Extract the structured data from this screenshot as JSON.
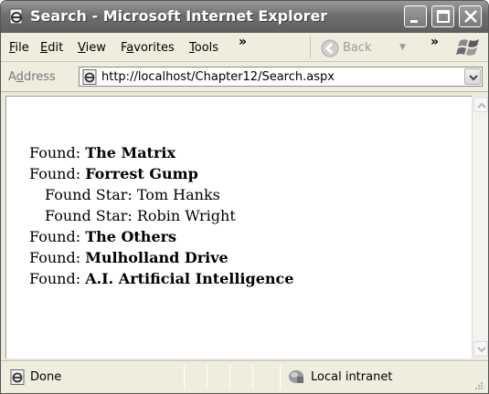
{
  "window": {
    "title": "Search - Microsoft Internet Explorer"
  },
  "menu": {
    "items": [
      {
        "mnemonic": "F",
        "rest": "ile"
      },
      {
        "mnemonic": "E",
        "rest": "dit"
      },
      {
        "mnemonic": "V",
        "rest": "iew"
      },
      {
        "pre": "F",
        "mnemonic": "a",
        "rest": "vorites"
      },
      {
        "mnemonic": "T",
        "rest": "ools"
      }
    ],
    "overflow": "»",
    "back_label": "Back",
    "toolbar_overflow": "»"
  },
  "address": {
    "label_pre": "A",
    "label_mnemonic": "d",
    "label_rest": "dress",
    "url": "http://localhost/Chapter12/Search.aspx"
  },
  "content": {
    "lines": [
      {
        "prefix": "Found: ",
        "value": "The Matrix",
        "bold": true
      },
      {
        "prefix": "Found: ",
        "value": "Forrest Gump",
        "bold": true
      },
      {
        "prefix": "Found Star: ",
        "value": "Tom Hanks",
        "bold": false,
        "indent": true
      },
      {
        "prefix": "Found Star: ",
        "value": "Robin Wright",
        "bold": false,
        "indent": true
      },
      {
        "prefix": "Found: ",
        "value": "The Others",
        "bold": true
      },
      {
        "prefix": "Found: ",
        "value": "Mulholland Drive",
        "bold": true
      },
      {
        "prefix": "Found: ",
        "value": "A.I. Artificial Intelligence",
        "bold": true
      }
    ]
  },
  "status": {
    "text": "Done",
    "zone": "Local intranet"
  },
  "icons": [
    "ie-page-icon",
    "minimize-icon",
    "maximize-icon",
    "close-icon",
    "back-arrow-icon",
    "windows-logo-icon",
    "dropdown-arrow-icon",
    "scroll-up-icon",
    "scroll-down-icon",
    "intranet-icon",
    "resize-grip-icon"
  ]
}
